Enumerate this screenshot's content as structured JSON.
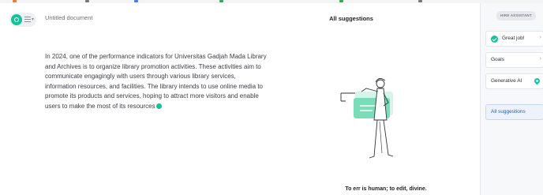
{
  "editor": {
    "document_title": "Untitled document",
    "body_text": "In 2024, one of the performance indicators for Universitas Gadjah Mada Library and Archives is to organize library promotion activities. These activities aim to communicate engagingly with users through various library services, information resources, and facilities. The library intends to use online media to promote its products and services, hoping to attract more visitors and enable users to make the most of its resources"
  },
  "suggestions": {
    "title": "All suggestions",
    "caption": "To err is human; to edit, divine."
  },
  "assistant": {
    "hire_badge": "HIRE ASSISTANT",
    "cards": [
      {
        "label": "Great job!",
        "icon": "check-circle-icon"
      },
      {
        "label": "Goals",
        "icon": ""
      },
      {
        "label": "Generative AI",
        "icon": "pin-icon"
      }
    ],
    "all_suggestions": "All suggestions"
  },
  "colors": {
    "brand": "#15c39a",
    "link": "#2c5aa0"
  }
}
